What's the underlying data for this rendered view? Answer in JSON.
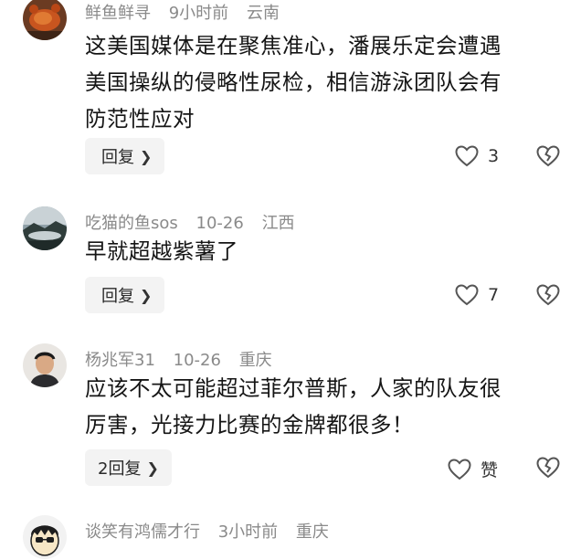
{
  "comments": [
    {
      "username": "鲜鱼鲜寻",
      "time": "9小时前",
      "location": "云南",
      "text_lines": [
        "这美国媒体是在聚焦准心，潘展乐定会遭遇",
        "美国操纵的侵略性尿检，相信游泳团队会有",
        "防范性应对"
      ],
      "reply_label": "回复",
      "like_count": "3",
      "avatar_icon": "crab-avatar-icon"
    },
    {
      "username": "吃猫的鱼sos",
      "time": "10-26",
      "location": "江西",
      "text_lines": [
        "早就超越紫薯了"
      ],
      "reply_label": "回复",
      "like_count": "7",
      "avatar_icon": "landscape-avatar-icon"
    },
    {
      "username": "杨兆军31",
      "time": "10-26",
      "location": "重庆",
      "text_lines": [
        "应该不太可能超过菲尔普斯，人家的队友很",
        "厉害，光接力比赛的金牌都很多！"
      ],
      "reply_label": "2回复",
      "like_count": "赞",
      "avatar_icon": "man-portrait-avatar-icon"
    },
    {
      "username": "谈笑有鸿儒才行",
      "time": "3小时前",
      "location": "重庆",
      "avatar_icon": "cartoon-avatar-icon"
    }
  ],
  "colors": {
    "meta": "#8a8a8a",
    "button_bg": "#f3f3f3",
    "text": "#151515"
  }
}
